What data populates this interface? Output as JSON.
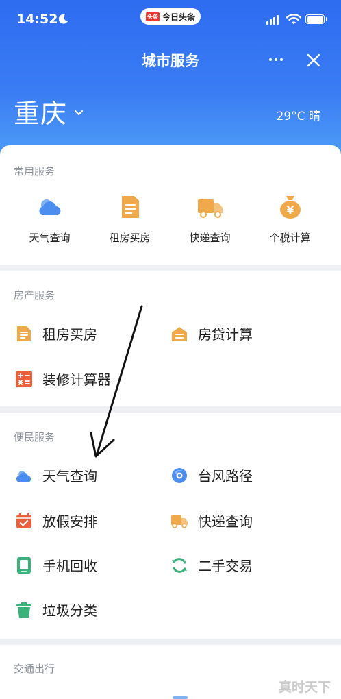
{
  "status_bar": {
    "time": "14:52",
    "app_name": "今日头条",
    "app_logo_text": "头条"
  },
  "nav": {
    "title": "城市服务"
  },
  "city": {
    "name": "重庆",
    "weather": "29°C 晴"
  },
  "sections": {
    "common": {
      "title": "常用服务",
      "items": [
        {
          "label": "天气查询",
          "icon": "cloud-icon"
        },
        {
          "label": "租房买房",
          "icon": "document-icon"
        },
        {
          "label": "快递查询",
          "icon": "truck-icon"
        },
        {
          "label": "个税计算",
          "icon": "money-bag-icon"
        }
      ]
    },
    "house": {
      "title": "房产服务",
      "items": [
        {
          "label": "租房买房",
          "icon": "document-icon"
        },
        {
          "label": "房贷计算",
          "icon": "house-icon"
        },
        {
          "label": "装修计算器",
          "icon": "calculator-icon"
        }
      ]
    },
    "life": {
      "title": "便民服务",
      "items": [
        {
          "label": "天气查询",
          "icon": "cloud-icon"
        },
        {
          "label": "台风路径",
          "icon": "typhoon-icon"
        },
        {
          "label": "放假安排",
          "icon": "calendar-icon"
        },
        {
          "label": "快递查询",
          "icon": "truck-icon"
        },
        {
          "label": "手机回收",
          "icon": "phone-recycle-icon"
        },
        {
          "label": "二手交易",
          "icon": "refresh-icon"
        },
        {
          "label": "垃圾分类",
          "icon": "trash-icon"
        }
      ]
    },
    "traffic": {
      "title": "交通出行"
    }
  },
  "watermark": "真时天下",
  "colors": {
    "header_blue": "#2e6cf0",
    "orange": "#f0a94a",
    "red": "#e8603c",
    "blue": "#4b8ef0",
    "green": "#3bb27a"
  }
}
